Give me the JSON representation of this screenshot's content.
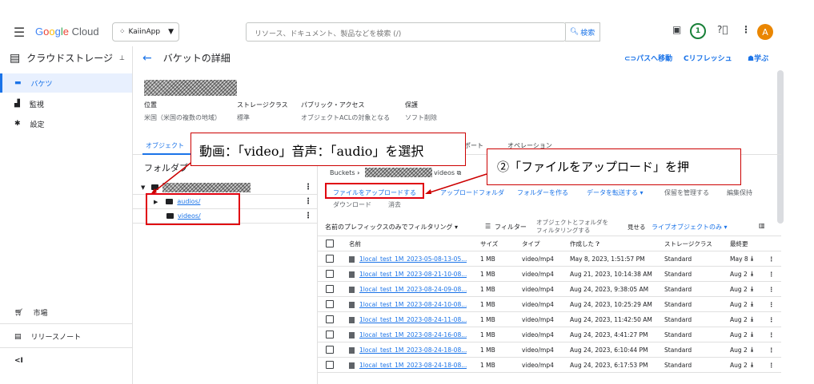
{
  "topbar": {
    "logo_prefix": "Google",
    "logo_suffix": "Cloud",
    "project": "KaiinApp",
    "search_placeholder": "リソース、ドキュメント、製品などを検索 (/)",
    "search_button": "検索",
    "notification_count": "1",
    "avatar_letter": "A"
  },
  "sidebar": {
    "title": "クラウドストレージ",
    "items": [
      {
        "label": "バケツ",
        "icon": "bucket-icon"
      },
      {
        "label": "監視",
        "icon": "chart-icon"
      },
      {
        "label": "設定",
        "icon": "gear-icon"
      }
    ],
    "bottom": [
      {
        "label": "市場",
        "icon": "cart-icon"
      },
      {
        "label": "リリースノート",
        "icon": "notes-icon"
      }
    ],
    "collapse": "<I"
  },
  "header": {
    "title": "バケットの詳細",
    "actions": [
      "パスへ移動",
      "リフレッシュ",
      "学ぶ"
    ]
  },
  "bucket_meta": {
    "labels": [
      "位置",
      "ストレージクラス",
      "パブリック・アクセス",
      "保護"
    ],
    "values": [
      "米国（米国の複数の地域）",
      "標準",
      "オブジェクトACLの対象となる",
      "ソフト削除"
    ]
  },
  "tabs": [
    "オブジェクト",
    "ポート",
    "オペレーション"
  ],
  "folder_panel": {
    "title": "フォルダブ",
    "folders": [
      "audios/",
      "videos/"
    ]
  },
  "breadcrumb": {
    "root": "Buckets",
    "current": "videos"
  },
  "actions": {
    "upload_file": "ファイルをアップロードする",
    "upload_folder": "アップロードフォルダ",
    "create_folder": "フォルダーを作る",
    "transfer": "データを転送する ▾",
    "manage_retention": "保留を管理する",
    "edit_retention": "編集保持",
    "download": "ダウンロード",
    "delete": "消去"
  },
  "filter_bar": {
    "prefix_filter": "名前のプレフィックスのみでフィルタリング ▾",
    "filter": "フィルター",
    "filter_desc_1": "オブジェクトとフォルダを",
    "filter_desc_2": "フィルタリングする",
    "show": "見せる",
    "show_value": "ライブオブジェクトのみ ▾"
  },
  "table": {
    "columns": [
      "名前",
      "サイズ",
      "タイプ",
      "作成した",
      "ストレージクラス",
      "最終更"
    ],
    "rows": [
      {
        "name": "1local_test_1M_2023-05-08-13-05...",
        "size": "1 MB",
        "type": "video/mp4",
        "created": "May 8, 2023, 1:51:57 PM",
        "class": "Standard",
        "last": "May 8"
      },
      {
        "name": "1local_test_1M_2023-08-21-10-08...",
        "size": "1 MB",
        "type": "video/mp4",
        "created": "Aug 21, 2023, 10:14:38 AM",
        "class": "Standard",
        "last": "Aug 2"
      },
      {
        "name": "1local_test_1M_2023-08-24-09-08...",
        "size": "1 MB",
        "type": "video/mp4",
        "created": "Aug 24, 2023, 9:38:05 AM",
        "class": "Standard",
        "last": "Aug 2"
      },
      {
        "name": "1local_test_1M_2023-08-24-10-08...",
        "size": "1 MB",
        "type": "video/mp4",
        "created": "Aug 24, 2023, 10:25:29 AM",
        "class": "Standard",
        "last": "Aug 2"
      },
      {
        "name": "1local_test_1M_2023-08-24-11-08...",
        "size": "1 MB",
        "type": "video/mp4",
        "created": "Aug 24, 2023, 11:42:50 AM",
        "class": "Standard",
        "last": "Aug 2"
      },
      {
        "name": "1local_test_1M_2023-08-24-16-08...",
        "size": "1 MB",
        "type": "video/mp4",
        "created": "Aug 24, 2023, 4:41:27 PM",
        "class": "Standard",
        "last": "Aug 2"
      },
      {
        "name": "1local_test_1M_2023-08-24-18-08...",
        "size": "1 MB",
        "type": "video/mp4",
        "created": "Aug 24, 2023, 6:10:44 PM",
        "class": "Standard",
        "last": "Aug 2"
      },
      {
        "name": "1local_test_1M_2023-08-24-18-08...",
        "size": "1 MB",
        "type": "video/mp4",
        "created": "Aug 24, 2023, 6:17:53 PM",
        "class": "Standard",
        "last": "Aug 2"
      }
    ]
  },
  "annotations": {
    "callout_1": "動画：「video」音声：「audio」を選択",
    "callout_2": "②「ファイルをアップロード」を押"
  }
}
